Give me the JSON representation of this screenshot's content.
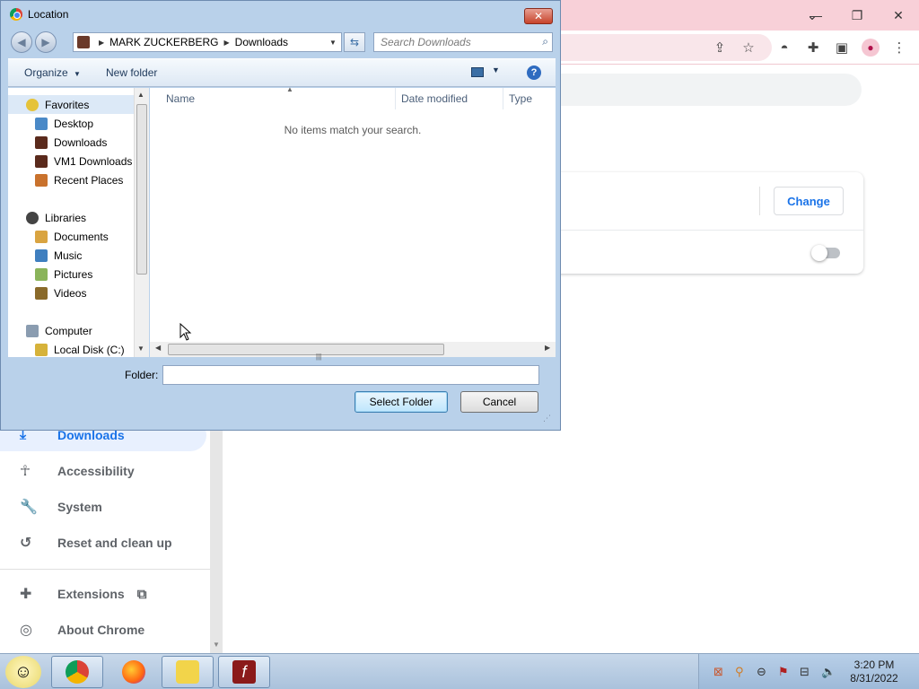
{
  "chrome": {
    "change_label": "Change",
    "sidebar": [
      {
        "label": "Downloads",
        "icon": "download-icon",
        "active": true
      },
      {
        "label": "Accessibility",
        "icon": "accessibility-icon",
        "active": false
      },
      {
        "label": "System",
        "icon": "wrench-icon",
        "active": false
      },
      {
        "label": "Reset and clean up",
        "icon": "reset-icon",
        "active": false
      },
      {
        "label": "Extensions",
        "icon": "puzzle-icon",
        "active": false
      },
      {
        "label": "About Chrome",
        "icon": "chrome-icon",
        "active": false
      }
    ],
    "accent_color": "#1a73e8"
  },
  "dialog": {
    "title": "Location",
    "close_label": "✕",
    "address": {
      "root": "MARK ZUCKERBERG",
      "current": "Downloads"
    },
    "search_placeholder": "Search Downloads",
    "toolbar": {
      "organize_label": "Organize",
      "new_folder_label": "New folder"
    },
    "nav": {
      "favorites_header": "Favorites",
      "favorites": [
        "Desktop",
        "Downloads",
        "VM1 Downloads",
        "Recent Places"
      ],
      "libraries_header": "Libraries",
      "libraries": [
        "Documents",
        "Music",
        "Pictures",
        "Videos"
      ],
      "computer_header": "Computer",
      "computer": [
        "Local Disk (C:)"
      ]
    },
    "columns": [
      "Name",
      "Date modified",
      "Type"
    ],
    "empty_message": "No items match your search.",
    "folder_label": "Folder:",
    "folder_value": "",
    "select_folder_label": "Select Folder",
    "cancel_label": "Cancel"
  },
  "taskbar": {
    "apps": [
      "chrome-icon",
      "firefox-icon",
      "explorer-icon",
      "flash-icon"
    ],
    "time": "3:20 PM",
    "date": "8/31/2022"
  }
}
